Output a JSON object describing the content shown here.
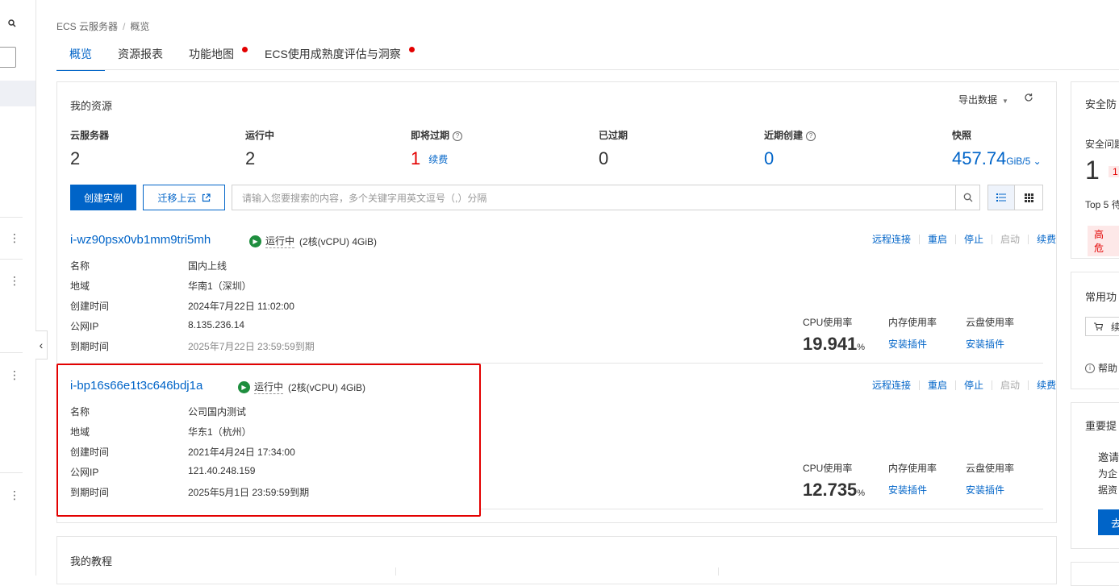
{
  "breadcrumb": [
    "ECS 云服务器",
    "概览"
  ],
  "tabs": [
    {
      "label": "概览",
      "active": true,
      "dot": false
    },
    {
      "label": "资源报表",
      "active": false,
      "dot": false
    },
    {
      "label": "功能地图",
      "active": false,
      "dot": true
    },
    {
      "label": "ECS使用成熟度评估与洞察",
      "active": false,
      "dot": true
    }
  ],
  "resources": {
    "title": "我的资源",
    "export": "导出数据",
    "stats": [
      {
        "label": "云服务器",
        "value": "2"
      },
      {
        "label": "运行中",
        "value": "2"
      },
      {
        "label": "即将过期",
        "value": "1",
        "link": "续费"
      },
      {
        "label": "已过期",
        "value": "0"
      },
      {
        "label": "近期创建",
        "value": "0"
      },
      {
        "label": "快照",
        "value": "457.74",
        "unit": "GiB/5"
      }
    ],
    "create_btn": "创建实例",
    "migrate_btn": "迁移上云",
    "search_placeholder": "请输入您要搜索的内容，多个关键字用英文逗号（,）分隔"
  },
  "instances": [
    {
      "id": "i-wz90psx0vb1mm9tri5mh",
      "status": "运行中",
      "spec": "(2核(vCPU) 4GiB)",
      "actions": [
        "远程连接",
        "重启",
        "停止",
        "启动",
        "续费"
      ],
      "fields": [
        {
          "label": "名称",
          "value": "国内上线"
        },
        {
          "label": "地域",
          "value": "华南1（深圳）"
        },
        {
          "label": "创建时间",
          "value": "2024年7月22日 11:02:00"
        },
        {
          "label": "公网IP",
          "value": "8.135.236.14"
        },
        {
          "label": "到期时间",
          "value": "2025年7月22日 23:59:59到期"
        }
      ],
      "cpu_label": "CPU使用率",
      "cpu_value": "19.941",
      "cpu_unit": "%",
      "mem_label": "内存使用率",
      "mem_link": "安装插件",
      "disk_label": "云盘使用率",
      "disk_link": "安装插件"
    },
    {
      "id": "i-bp16s66e1t3c646bdj1a",
      "status": "运行中",
      "spec": "(2核(vCPU) 4GiB)",
      "actions": [
        "远程连接",
        "重启",
        "停止",
        "启动",
        "续费"
      ],
      "fields": [
        {
          "label": "名称",
          "value": "公司国内测试"
        },
        {
          "label": "地域",
          "value": "华东1（杭州）"
        },
        {
          "label": "创建时间",
          "value": "2021年4月24日 17:34:00"
        },
        {
          "label": "公网IP",
          "value": "121.40.248.159"
        },
        {
          "label": "到期时间",
          "value": "2025年5月1日 23:59:59到期"
        }
      ],
      "cpu_label": "CPU使用率",
      "cpu_value": "12.735",
      "cpu_unit": "%",
      "mem_label": "内存使用率",
      "mem_link": "安装插件",
      "disk_label": "云盘使用率",
      "disk_link": "安装插件"
    }
  ],
  "tutorial": {
    "title": "我的教程"
  },
  "right": {
    "security_title": "安全防",
    "security_issue": "安全问题",
    "security_count": "1",
    "security_small": "1",
    "top5": "Top 5 待",
    "risk": "高危",
    "common_title": "常用功",
    "renew_short": "续",
    "help": "帮助",
    "important_title": "重要提",
    "invite": "邀请",
    "line1": "为企",
    "line2": "据资",
    "go": "去"
  },
  "colors": {
    "primary": "#0064c8",
    "danger": "#e30000",
    "running": "#1e8e3e"
  }
}
